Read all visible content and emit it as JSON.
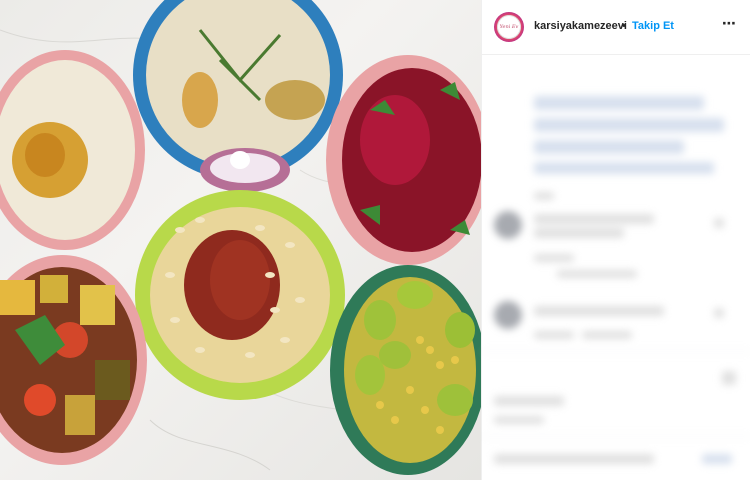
{
  "header": {
    "avatar_text": "Yeni Ev",
    "username": "karsiyakamezeevi",
    "separator": "•",
    "follow_label": "Takip Et",
    "more_icon": "⋯"
  },
  "photo": {
    "alt_icon": "food-photo",
    "colors": {
      "marble": "#eeedea",
      "pink_bowl": "#e9a3a5",
      "blue_bowl": "#3a8cc8",
      "yellow_bowl": "#b5d64a",
      "green_bowl": "#2f7a58"
    }
  },
  "panel": {
    "follow_color": "#0095f6"
  }
}
